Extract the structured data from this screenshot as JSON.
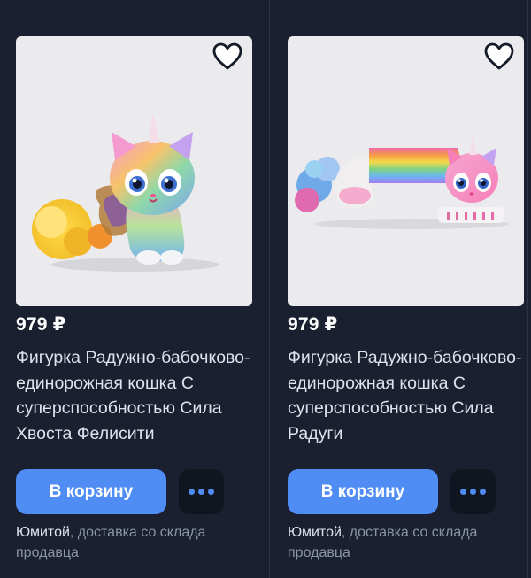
{
  "cards": [
    {
      "price": "979 ₽",
      "title": "Фигурка Радужно-бабочково-единорожная кошка С суперспособностью Сила Хвоста Фелисити",
      "cart_label": "В корзину",
      "seller_name": "Юмитой",
      "delivery": ", доставка со склада продавца",
      "image_icon": "rainbow-unicorn-cat-figure",
      "favorite_icon": "heart-outline-icon",
      "more_icon": "three-dots-icon"
    },
    {
      "price": "979 ₽",
      "title": "Фигурка Радужно-бабочково-единорожная кошка С суперспособностью Сила Радуги",
      "cart_label": "В корзину",
      "seller_name": "Юмитой",
      "delivery": ", доставка со склада продавца",
      "image_icon": "rainbow-unicorn-cat-with-rainbow-tail",
      "favorite_icon": "heart-outline-icon",
      "more_icon": "three-dots-icon"
    }
  ],
  "colors": {
    "background": "#1a2030",
    "accent": "#4f8df5",
    "card_image_bg": "#ebebee"
  }
}
